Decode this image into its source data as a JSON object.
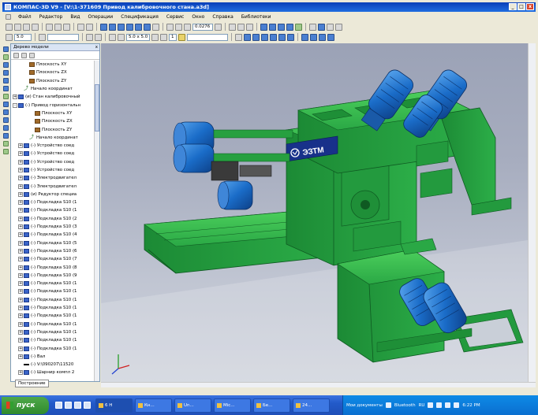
{
  "window": {
    "title": "КОМПАС-3D V9 - [V:\\1-371609 Привод калибровочного стана.a3d]",
    "min": "_",
    "max": "□",
    "close": "x"
  },
  "menu": [
    "Файл",
    "Редактор",
    "Вид",
    "Операции",
    "Спецификация",
    "Сервис",
    "Окно",
    "Справка",
    "Библиотеки"
  ],
  "toolbar": {
    "zoom_value": "0.0276",
    "scale_value": "5.0",
    "step_value": "5.0 x 5.0",
    "counter_value": "1"
  },
  "tree": {
    "panel_title": "Дерево модели",
    "close": "x",
    "rows": [
      {
        "indent": 2,
        "pm": "",
        "icon": "plane",
        "label": "Плоскость XY"
      },
      {
        "indent": 2,
        "pm": "",
        "icon": "plane",
        "label": "Плоскость ZX"
      },
      {
        "indent": 2,
        "pm": "",
        "icon": "plane",
        "label": "Плоскость ZY"
      },
      {
        "indent": 1,
        "pm": "",
        "icon": "origin",
        "label": "Начало координат"
      },
      {
        "indent": 0,
        "pm": "+",
        "icon": "part",
        "label": "(и) Стан калибровочный"
      },
      {
        "indent": 0,
        "pm": "-",
        "icon": "part",
        "label": "(-) Привод горизонтальн"
      },
      {
        "indent": 3,
        "pm": "",
        "icon": "plane",
        "label": "Плоскость XY"
      },
      {
        "indent": 3,
        "pm": "",
        "icon": "plane",
        "label": "Плоскость ZX"
      },
      {
        "indent": 3,
        "pm": "",
        "icon": "plane",
        "label": "Плоскость ZY"
      },
      {
        "indent": 2,
        "pm": "",
        "icon": "origin",
        "label": "Начало координат"
      },
      {
        "indent": 1,
        "pm": "+",
        "icon": "part",
        "label": "(-) Устройство соед"
      },
      {
        "indent": 1,
        "pm": "+",
        "icon": "part",
        "label": "(-) Устройство соед"
      },
      {
        "indent": 1,
        "pm": "+",
        "icon": "part",
        "label": "(-) Устройство соед"
      },
      {
        "indent": 1,
        "pm": "+",
        "icon": "part",
        "label": "(-) Устройство соед"
      },
      {
        "indent": 1,
        "pm": "+",
        "icon": "part",
        "label": "(-) Электродвигател"
      },
      {
        "indent": 1,
        "pm": "+",
        "icon": "part",
        "label": "(-) Электродвигател"
      },
      {
        "indent": 1,
        "pm": "+",
        "icon": "part",
        "label": "(и) Редуктор специа"
      },
      {
        "indent": 1,
        "pm": "+",
        "icon": "part",
        "label": "(-) Подкладка S10 (1"
      },
      {
        "indent": 1,
        "pm": "+",
        "icon": "part",
        "label": "(-) Подкладка S10 (1"
      },
      {
        "indent": 1,
        "pm": "+",
        "icon": "part",
        "label": "(-) Подкладка S10 (2"
      },
      {
        "indent": 1,
        "pm": "+",
        "icon": "part",
        "label": "(-) Подкладка S10 (3"
      },
      {
        "indent": 1,
        "pm": "+",
        "icon": "part",
        "label": "(-) Подкладка S10 (4"
      },
      {
        "indent": 1,
        "pm": "+",
        "icon": "part",
        "label": "(-) Подкладка S10 (5"
      },
      {
        "indent": 1,
        "pm": "+",
        "icon": "part",
        "label": "(-) Подкладка S10 (6"
      },
      {
        "indent": 1,
        "pm": "+",
        "icon": "part",
        "label": "(-) Подкладка S10 (7"
      },
      {
        "indent": 1,
        "pm": "+",
        "icon": "part",
        "label": "(-) Подкладка S10 (8"
      },
      {
        "indent": 1,
        "pm": "+",
        "icon": "part",
        "label": "(-) Подкладка S10 (9"
      },
      {
        "indent": 1,
        "pm": "+",
        "icon": "part",
        "label": "(-) Подкладка S10 (1"
      },
      {
        "indent": 1,
        "pm": "+",
        "icon": "part",
        "label": "(-) Подкладка S10 (1"
      },
      {
        "indent": 1,
        "pm": "+",
        "icon": "part",
        "label": "(-) Подкладка S10 (1"
      },
      {
        "indent": 1,
        "pm": "+",
        "icon": "part",
        "label": "(-) Подкладка S10 (1"
      },
      {
        "indent": 1,
        "pm": "+",
        "icon": "part",
        "label": "(-) Подкладка S10 (1"
      },
      {
        "indent": 1,
        "pm": "+",
        "icon": "part",
        "label": "(-) Подкладка S10 (1"
      },
      {
        "indent": 1,
        "pm": "+",
        "icon": "part",
        "label": "(-) Подкладка S10 (1"
      },
      {
        "indent": 1,
        "pm": "+",
        "icon": "part",
        "label": "(-) Подкладка S10 (1"
      },
      {
        "indent": 1,
        "pm": "+",
        "icon": "part",
        "label": "(-) Подкладка S10 (1"
      },
      {
        "indent": 1,
        "pm": "+",
        "icon": "part",
        "label": "(-) Вал"
      },
      {
        "indent": 1,
        "pm": "",
        "icon": "rod",
        "label": "(-) V:\\090207\\11520"
      },
      {
        "indent": 1,
        "pm": "+",
        "icon": "part",
        "label": "(-) Шарнир компл 2"
      }
    ]
  },
  "tab": {
    "label": "Построение"
  },
  "model": {
    "logo_text": "ЭЗТМ"
  },
  "taskbar": {
    "start_label": "пуск",
    "tasks": [
      "6 Н",
      "Кн...",
      "Un...",
      "Mic...",
      "Бе...",
      "24..."
    ],
    "tray_items": [
      "Мои документы",
      "Bluetooth",
      "RU"
    ],
    "clock": "6:22 PM"
  },
  "colors": {
    "machine_green": "#2aa845",
    "motor_blue": "#1a6cc8",
    "viewport_bg": "#a7adbf",
    "title_blue": "#0a3fb8"
  }
}
